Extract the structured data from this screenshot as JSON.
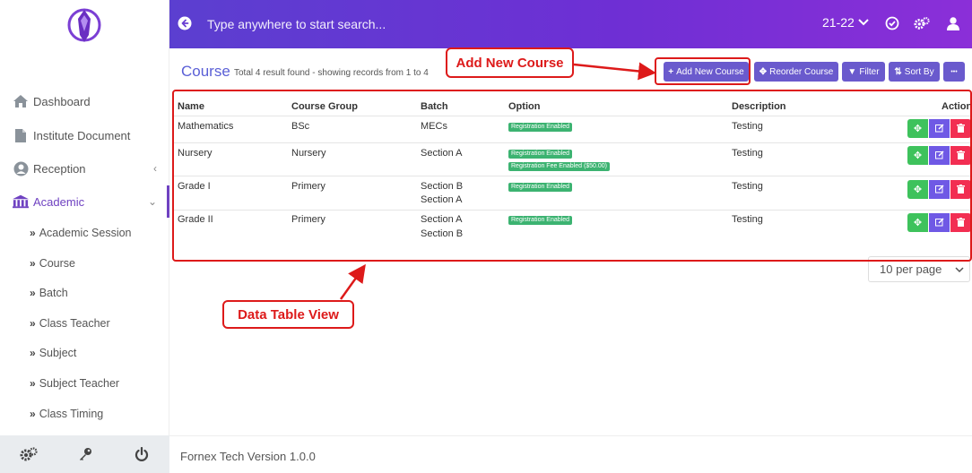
{
  "topbar": {
    "search_placeholder": "Type anywhere to start search...",
    "session": "21-22"
  },
  "sidebar": {
    "items": [
      {
        "label": "Dashboard",
        "icon": "home-icon"
      },
      {
        "label": "Institute Document",
        "icon": "document-icon"
      },
      {
        "label": "Reception",
        "icon": "user-circle-icon"
      },
      {
        "label": "Academic",
        "icon": "institution-icon"
      }
    ],
    "sub_items": [
      {
        "label": "Academic Session"
      },
      {
        "label": "Course"
      },
      {
        "label": "Batch"
      },
      {
        "label": "Class Teacher"
      },
      {
        "label": "Subject"
      },
      {
        "label": "Subject Teacher"
      },
      {
        "label": "Class Timing"
      }
    ]
  },
  "page": {
    "title": "Course",
    "subtitle": "Total 4 result found - showing records from 1 to 4"
  },
  "toolbar": {
    "add_label": "Add New Course",
    "reorder_label": "Reorder Course",
    "filter_label": "Filter",
    "sort_label": "Sort By",
    "more_label": "•••"
  },
  "table": {
    "headers": [
      "Name",
      "Course Group",
      "Batch",
      "Option",
      "Description",
      "Action"
    ],
    "rows": [
      {
        "name": "Mathematics",
        "group": "BSc",
        "batch": [
          "MECs"
        ],
        "options": [
          "Registration Enabled"
        ],
        "description": "Testing"
      },
      {
        "name": "Nursery",
        "group": "Nursery",
        "batch": [
          "Section A"
        ],
        "options": [
          "Registration Enabled",
          "Registration Fee Enabled ($50.00)"
        ],
        "description": "Testing"
      },
      {
        "name": "Grade I",
        "group": "Primery",
        "batch": [
          "Section B",
          "Section A"
        ],
        "options": [
          "Registration Enabled"
        ],
        "description": "Testing"
      },
      {
        "name": "Grade II",
        "group": "Primery",
        "batch": [
          "Section A",
          "Section B"
        ],
        "options": [
          "Registration Enabled"
        ],
        "description": "Testing"
      }
    ]
  },
  "pagination": {
    "per_page": "10 per page"
  },
  "annotations": {
    "add_new_course": "Add New Course",
    "data_table_view": "Data Table View"
  },
  "footer": {
    "version": "Fornex Tech Version 1.0.0"
  },
  "colors": {
    "accent": "#6f42c1",
    "topbar_start": "#5b3fd0",
    "topbar_end": "#8b2fd8",
    "badge_green": "#3cb371",
    "annotation_red": "#dd1a1a"
  }
}
